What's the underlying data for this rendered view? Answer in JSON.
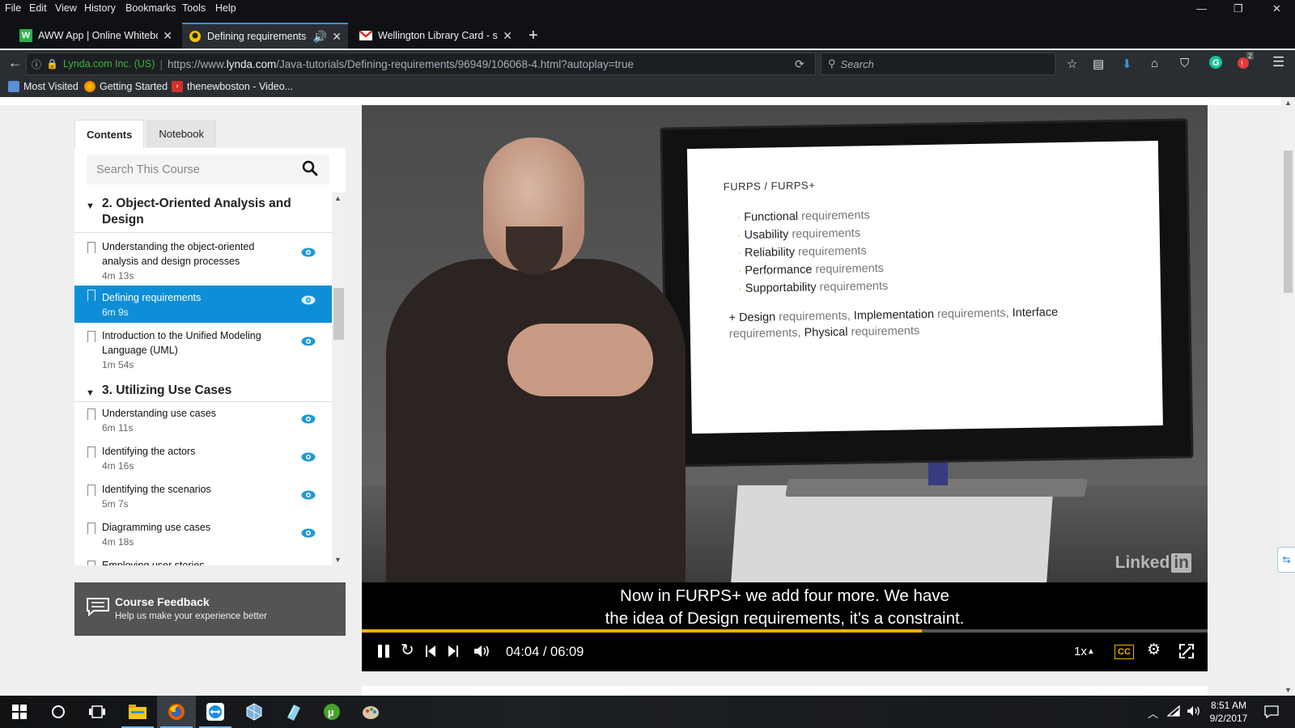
{
  "browser": {
    "menu": [
      "File",
      "Edit",
      "View",
      "History",
      "Bookmarks",
      "Tools",
      "Help"
    ],
    "tabs": [
      {
        "title": "AWW App | Online Whiteboa",
        "icon": "W"
      },
      {
        "title": "Defining requirements",
        "icon": "lynda"
      },
      {
        "title": "Wellington Library Card - sh",
        "icon": "gmail"
      }
    ],
    "url": {
      "identity": "Lynda.com Inc. (US)",
      "prefix": "https://www.",
      "domain": "lynda.com",
      "path": "/Java-tutorials/Defining-requirements/96949/106068-4.html?autoplay=true"
    },
    "search_placeholder": "Search",
    "bookmarks": [
      "Most Visited",
      "Getting Started",
      "thenewboston - Video..."
    ],
    "notification_badge": "2"
  },
  "sidebar": {
    "tabs": [
      "Contents",
      "Notebook"
    ],
    "search_placeholder": "Search This Course",
    "chapters": [
      {
        "title": "2. Object-Oriented Analysis and Design",
        "lessons": [
          {
            "title": "Understanding the object-oriented analysis and design processes",
            "duration": "4m 13s"
          },
          {
            "title": "Defining requirements",
            "duration": "6m 9s"
          },
          {
            "title": "Introduction to the Unified Modeling Language (UML)",
            "duration": "1m 54s"
          }
        ]
      },
      {
        "title": "3. Utilizing Use Cases",
        "lessons": [
          {
            "title": "Understanding use cases",
            "duration": "6m 11s"
          },
          {
            "title": "Identifying the actors",
            "duration": "4m 16s"
          },
          {
            "title": "Identifying the scenarios",
            "duration": "5m 7s"
          },
          {
            "title": "Diagramming use cases",
            "duration": "4m 18s"
          },
          {
            "title": "Employing user stories",
            "duration": ""
          }
        ]
      }
    ],
    "feedback": {
      "title": "Course Feedback",
      "subtitle": "Help us make your experience better"
    }
  },
  "video": {
    "slide": {
      "title": "FURPS / FURPS+",
      "items": [
        {
          "bold": "Functional",
          "rest": " requirements"
        },
        {
          "bold": "Usability",
          "rest": " requirements"
        },
        {
          "bold": "Reliability",
          "rest": " requirements"
        },
        {
          "bold": "Performance",
          "rest": " requirements"
        },
        {
          "bold": "Supportability",
          "rest": " requirements"
        }
      ],
      "plus_line": {
        "design": "+ Design",
        "req1": " requirements, ",
        "impl": "Implementation",
        "req2": " requirements, ",
        "interface": "Interface",
        "req3": " requirements, ",
        "physical": "Physical",
        "req4": " requirements"
      }
    },
    "watermark": "Linked",
    "watermark_in": "in",
    "caption_line1": "Now in FURPS+ we add four more. We have",
    "caption_line2": "the idea of Design requirements, it's a constraint.",
    "time": "04:04 / 06:09",
    "progress_fraction": 0.662,
    "speed": "1x",
    "cc": "CC"
  },
  "taskbar": {
    "time": "8:51 AM",
    "date": "9/2/2017"
  },
  "colors": {
    "accent": "#0e8ed6",
    "progress": "#f2b100",
    "secure": "#3ab53a"
  }
}
